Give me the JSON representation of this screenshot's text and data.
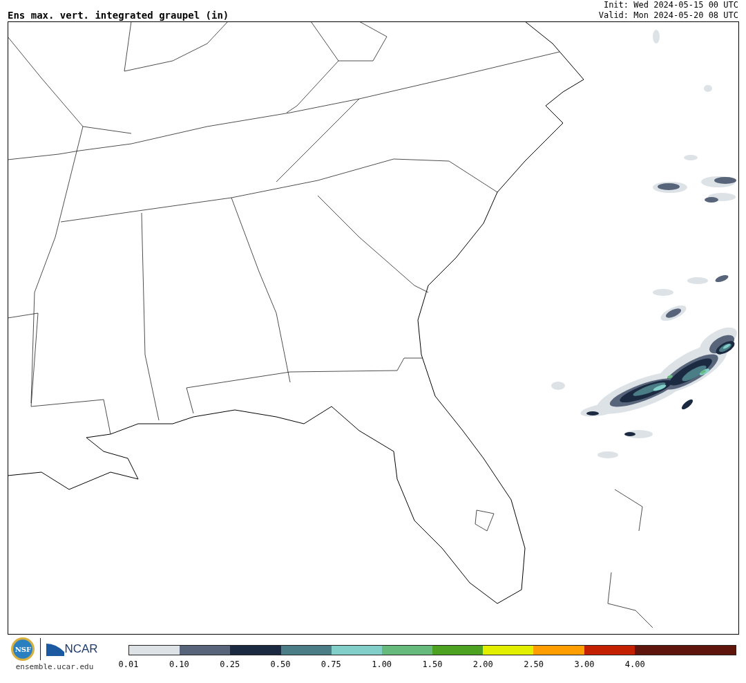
{
  "title": "Ens max. vert. integrated graupel (in)",
  "init": "Init: Wed 2024-05-15 00 UTC",
  "valid": "Valid: Mon 2024-05-20 08 UTC",
  "logos": {
    "nsf": "NSF",
    "ncar": "NCAR",
    "url": "ensemble.ucar.edu"
  },
  "legend": {
    "segments": [
      {
        "label": "0.01",
        "color": "#dde2e7"
      },
      {
        "label": "0.10",
        "color": "#576479"
      },
      {
        "label": "0.25",
        "color": "#1b2a41"
      },
      {
        "label": "0.50",
        "color": "#4b7d86"
      },
      {
        "label": "0.75",
        "color": "#82cfca"
      },
      {
        "label": "1.00",
        "color": "#66bb7c"
      },
      {
        "label": "1.50",
        "color": "#4ea222"
      },
      {
        "label": "2.00",
        "color": "#e2f000"
      },
      {
        "label": "2.50",
        "color": "#ff9e00"
      },
      {
        "label": "3.00",
        "color": "#c22000"
      },
      {
        "label": "4.00",
        "color": "#5e150b"
      },
      {
        "color": "#5e150b"
      }
    ]
  }
}
